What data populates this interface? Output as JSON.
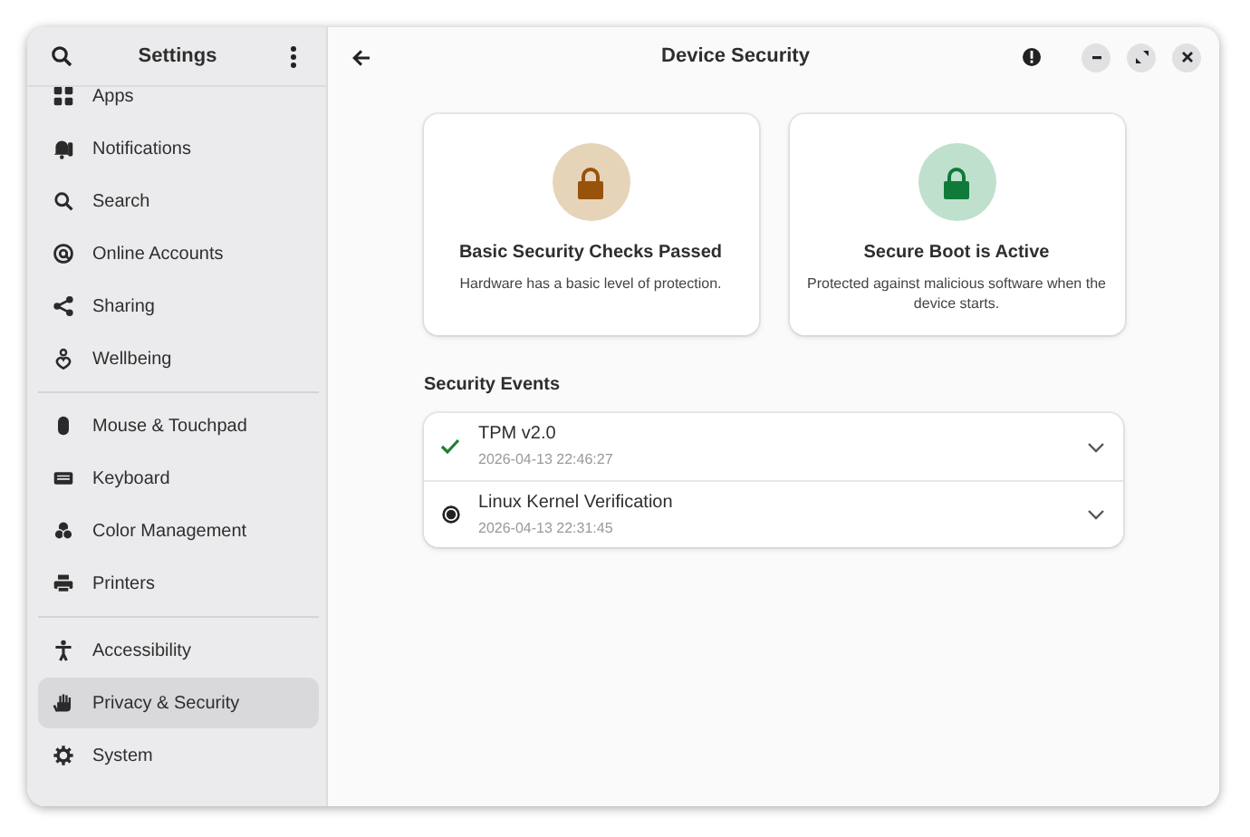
{
  "sidebar": {
    "title": "Settings",
    "groups": [
      {
        "items": [
          {
            "label": "Apps",
            "selected": false
          },
          {
            "label": "Notifications",
            "selected": false
          },
          {
            "label": "Search",
            "selected": false
          },
          {
            "label": "Online Accounts",
            "selected": false
          },
          {
            "label": "Sharing",
            "selected": false
          },
          {
            "label": "Wellbeing",
            "selected": false
          }
        ]
      },
      {
        "items": [
          {
            "label": "Mouse & Touchpad",
            "selected": false
          },
          {
            "label": "Keyboard",
            "selected": false
          },
          {
            "label": "Color Management",
            "selected": false
          },
          {
            "label": "Printers",
            "selected": false
          }
        ]
      },
      {
        "items": [
          {
            "label": "Accessibility",
            "selected": false
          },
          {
            "label": "Privacy & Security",
            "selected": true
          },
          {
            "label": "System",
            "selected": false
          }
        ]
      }
    ]
  },
  "header": {
    "title": "Device Security"
  },
  "cards": [
    {
      "kind": "warning",
      "title": "Basic Security Checks Passed",
      "description": "Hardware has a basic level of protection."
    },
    {
      "kind": "ok",
      "title": "Secure Boot is Active",
      "description": "Protected against malicious software when the device starts."
    }
  ],
  "events": {
    "title": "Security Events",
    "rows": [
      {
        "kind": "passed",
        "name": "TPM v2.0",
        "time": "2026-04-13 22:46:27"
      },
      {
        "kind": "unknown",
        "name": "Linux Kernel Verification",
        "time": "2026-04-13 22:31:45"
      }
    ]
  }
}
